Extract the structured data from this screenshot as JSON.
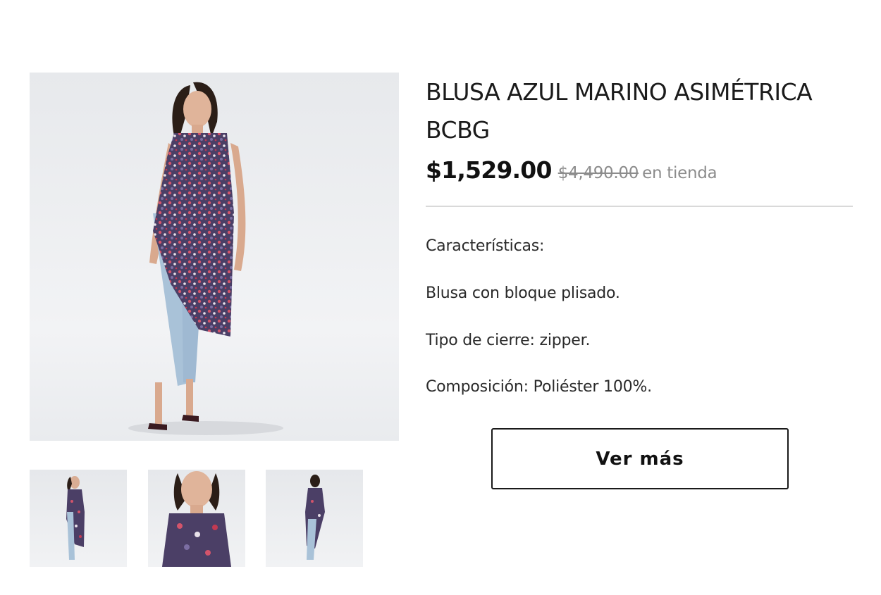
{
  "product": {
    "title": "BLUSA AZUL MARINO ASIMÉTRICA BCBG",
    "price": "$1,529.00",
    "old_price": "$4,490.00",
    "store_note": "en tienda"
  },
  "features": {
    "heading": "Características:",
    "items": [
      "Blusa con bloque plisado.",
      "Tipo de cierre: zipper.",
      "Composición: Poliéster 100%."
    ]
  },
  "actions": {
    "view_more_label": "Ver más"
  },
  "gallery": {
    "main_image": "model-front-full-image",
    "thumbnails": [
      "model-front-thumb",
      "model-closeup-thumb",
      "model-back-thumb"
    ]
  },
  "colors": {
    "text": "#1b1b1b",
    "muted": "#8c8c8c",
    "divider": "#d9d9d9",
    "dress_pattern": "#5a4a6e",
    "jeans": "#a9c2d8"
  }
}
